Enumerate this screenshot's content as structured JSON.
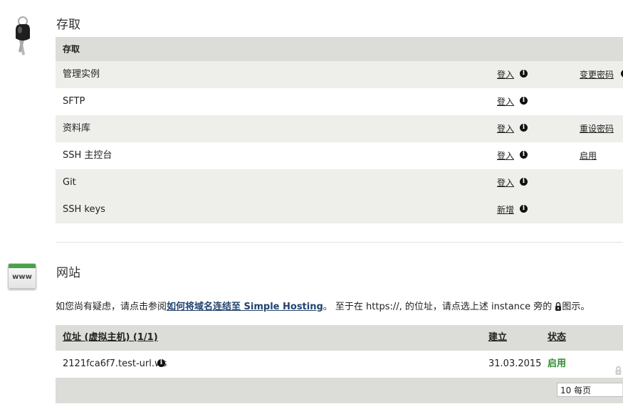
{
  "access": {
    "title": "存取",
    "header": "存取",
    "rows": [
      {
        "label": "管理实例",
        "login": "登入",
        "action": "变更密码"
      },
      {
        "label": "SFTP",
        "login": "登入",
        "action": ""
      },
      {
        "label": "资料库",
        "login": "登入",
        "action": "重设密码"
      },
      {
        "label": "SSH 主控台",
        "login": "登入",
        "action": "启用"
      },
      {
        "label": "Git",
        "login": "登入",
        "action": ""
      },
      {
        "label": "SSH keys",
        "login": "新增",
        "action": ""
      }
    ]
  },
  "website": {
    "title": "网站",
    "icon_text": "www",
    "note_before": "如您尚有疑虑，请点击参阅",
    "note_link": "如何将域名连结至 Simple Hosting",
    "note_after": "。 至于在 https://, 的位址，请点选上述 instance 旁的",
    "note_end": "图示。",
    "table": {
      "col_address": "位址 (虚拟主机) (1/1)",
      "col_created": "建立",
      "col_status": "状态",
      "rows": [
        {
          "address": "2121fca6f7.test-url.ws",
          "created": "31.03.2015",
          "status": "启用"
        }
      ],
      "per_page": "10 每页"
    }
  },
  "colors": {
    "header_bg": "#dcdcd8",
    "alt_row_bg": "#eeeeeb",
    "status_green": "#2e8b2e",
    "link_blue": "#23436e"
  },
  "icons": {
    "access": "keys-icon",
    "info": "info-icon",
    "website": "www-icon",
    "lock": "lock-icon"
  }
}
